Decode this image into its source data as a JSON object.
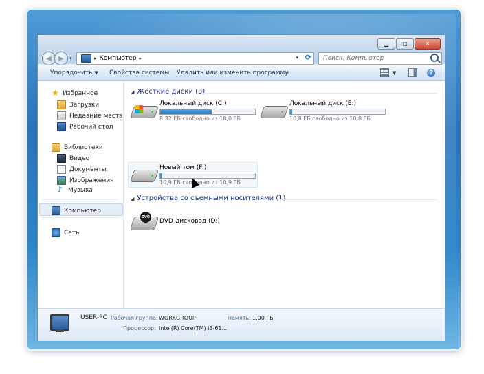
{
  "address": {
    "path": "Компьютер",
    "separator": "▸"
  },
  "search": {
    "placeholder": "Поиск: Компьютер"
  },
  "toolbar": {
    "organize": "Упорядочить",
    "system_properties": "Свойства системы",
    "uninstall": "Удалить или изменить программу",
    "more": "»"
  },
  "nav": {
    "favorites": "Избранное",
    "downloads": "Загрузки",
    "recent": "Недавние места",
    "desktop": "Рабочий стол",
    "libraries": "Библиотеки",
    "video": "Видео",
    "documents": "Документы",
    "pictures": "Изображения",
    "music": "Музыка",
    "computer": "Компьютер",
    "network": "Сеть"
  },
  "groups": {
    "hard_disks": "Жесткие диски (3)",
    "removable": "Устройства со съемными носителями (1)"
  },
  "drives": [
    {
      "name": "Локальный диск (C:)",
      "free": "8,32 ГБ свободно из 18,0 ГБ",
      "used_fraction": 0.54
    },
    {
      "name": "Локальный диск (E:)",
      "free": "10,8 ГБ свободно из 10,8 ГБ",
      "used_fraction": 0.01
    },
    {
      "name": "Новый том (F:)",
      "free": "10,9 ГБ свободно из 10,9 ГБ",
      "used_fraction": 0.01
    }
  ],
  "dvd": {
    "name": "DVD-дисковод (D:)",
    "badge": "DVD"
  },
  "details": {
    "pc_name": "USER-PC",
    "workgroup_label": "Рабочая группа:",
    "workgroup_value": "WORKGROUP",
    "memory_label": "Память:",
    "memory_value": "1,00 ГБ",
    "cpu_label": "Процессор:",
    "cpu_value": "Intel(R) Core(TM) i3-61..."
  },
  "colors": {
    "accent": "#2a7ec5",
    "group_header": "#1e3287"
  }
}
